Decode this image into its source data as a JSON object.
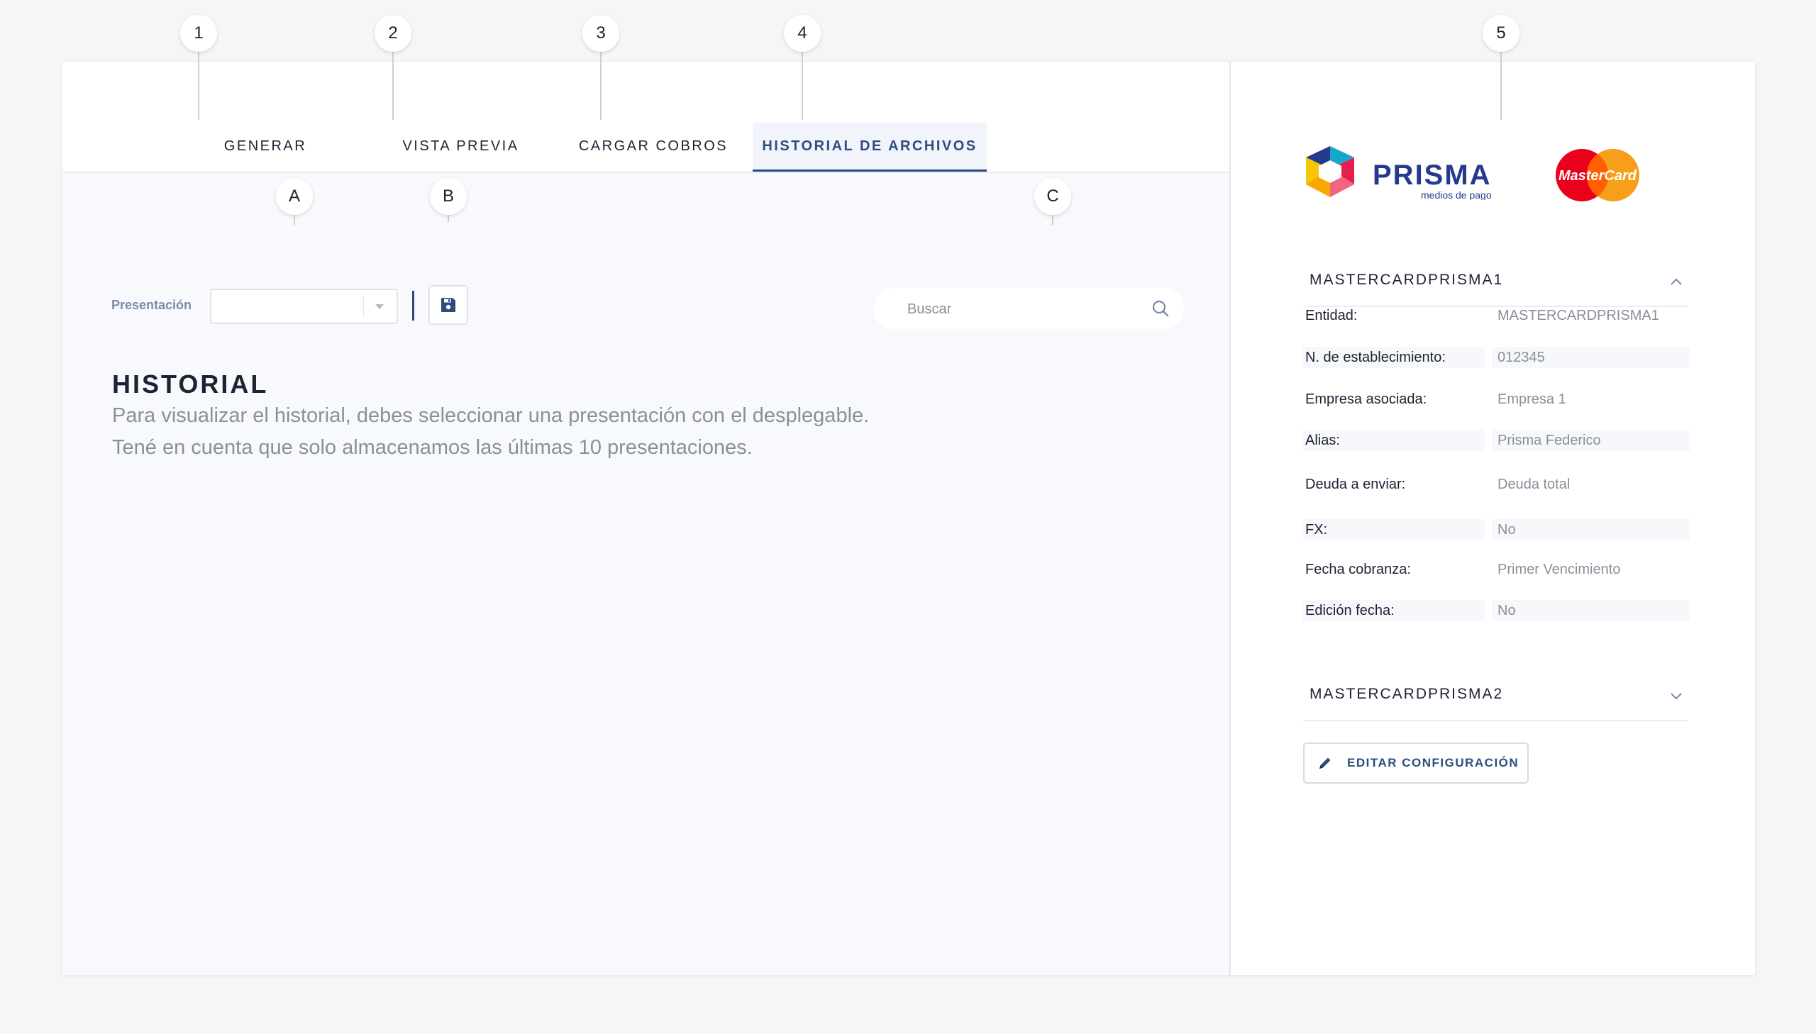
{
  "annotations": [
    "1",
    "2",
    "3",
    "4",
    "5",
    "A",
    "B",
    "C"
  ],
  "tabs": [
    {
      "label": "GENERAR",
      "active": false
    },
    {
      "label": "VISTA PREVIA",
      "active": false
    },
    {
      "label": "CARGAR COBROS",
      "active": false
    },
    {
      "label": "HISTORIAL DE ARCHIVOS",
      "active": true
    }
  ],
  "toolbar": {
    "presentation_label": "Presentación",
    "presentation_value": "",
    "search_placeholder": "Buscar"
  },
  "history": {
    "title": "HISTORIAL",
    "line1": "Para visualizar el historial, debes seleccionar una presentación con el desplegable.",
    "line2": "Tené en cuenta que solo almacenamos las últimas 10 presentaciones."
  },
  "logos": {
    "prisma_name": "PRISMA",
    "prisma_tagline": "medios de pago",
    "card_brand": "MasterCard"
  },
  "config_panel": {
    "accordion1_title": "MASTERCARDPRISMA1",
    "accordion1_expanded": true,
    "fields": [
      {
        "key": "Entidad:",
        "value": "MASTERCARDPRISMA1"
      },
      {
        "key": "N. de establecimiento:",
        "value": "012345"
      },
      {
        "key": "Empresa asociada:",
        "value": "Empresa 1"
      },
      {
        "key": "Alias:",
        "value": "Prisma Federico"
      },
      {
        "key": "Deuda a enviar:",
        "value": "Deuda total"
      },
      {
        "key": "FX:",
        "value": "No"
      },
      {
        "key": "Fecha cobranza:",
        "value": "Primer Vencimiento"
      },
      {
        "key": "Edición fecha:",
        "value": "No"
      }
    ],
    "accordion2_title": "MASTERCARDPRISMA2",
    "accordion2_expanded": false,
    "edit_label": "EDITAR CONFIGURACIÓN"
  },
  "colors": {
    "accent": "#2d4c7e",
    "muted_text": "#8a8f99",
    "mastercard_red": "#eb001b",
    "mastercard_orange": "#f79e1b"
  }
}
